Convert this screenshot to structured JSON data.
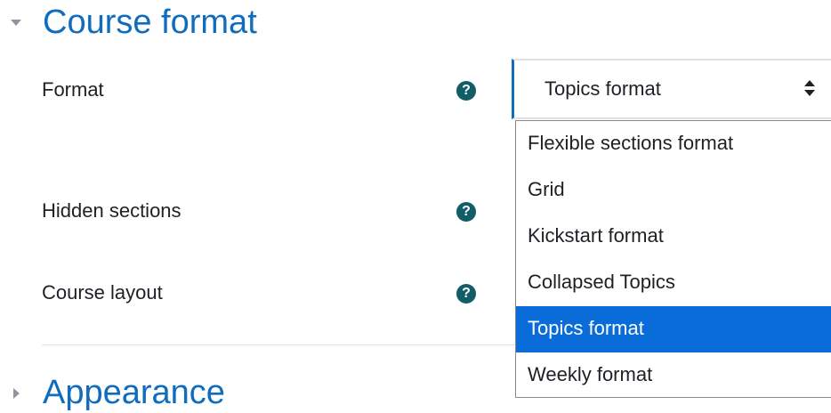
{
  "sections": {
    "course_format": {
      "title": "Course format",
      "expanded": true
    },
    "appearance": {
      "title": "Appearance",
      "expanded": false
    }
  },
  "fields": {
    "format": {
      "label": "Format",
      "help": "?"
    },
    "hidden_sections": {
      "label": "Hidden sections",
      "help": "?"
    },
    "course_layout": {
      "label": "Course layout",
      "help": "?"
    }
  },
  "format_select": {
    "value": "Topics format",
    "options": [
      "Flexible sections format",
      "Grid",
      "Kickstart format",
      "Collapsed Topics",
      "Topics format",
      "Weekly format"
    ],
    "highlighted_index": 4
  },
  "colors": {
    "heading": "#0f6cbf",
    "help_icon": "#115e67",
    "highlight": "#0a6cd8",
    "focus_border": "#0f6cbf"
  }
}
